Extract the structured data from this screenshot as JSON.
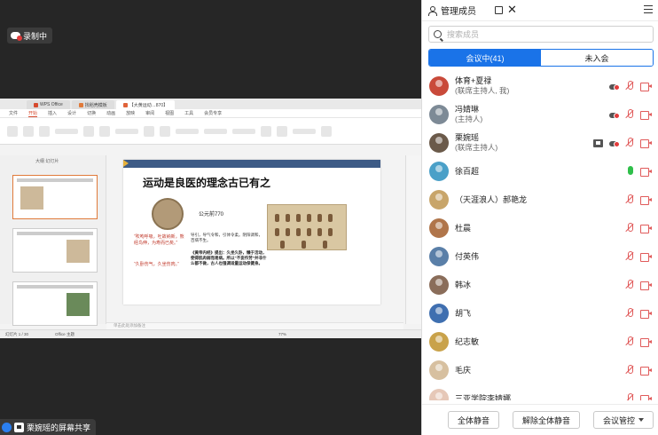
{
  "recording": {
    "label": "录制中"
  },
  "share": {
    "label": "栗婉瑶的屏幕共享"
  },
  "wps": {
    "tabs": [
      "WPS Office",
      "找稻壳模板",
      "【大黄运动…870】"
    ],
    "menu": [
      "文件",
      "开始",
      "插入",
      "设计",
      "切换",
      "动画",
      "放映",
      "审阅",
      "视图",
      "工具",
      "会员专享"
    ],
    "outline_tabs": "大纲 幻灯片",
    "notes_placeholder": "单击此处添加备注",
    "status_left": "幻灯片 1 / 30",
    "status_theme": "Office 主题",
    "status_zoom": "77%",
    "slide": {
      "title": "运动是良医的理念古已有之",
      "year": "公元前770",
      "red1": "“吹呴呼吸，吐故纳新，熊经鸟伸，为寿而已矣。”",
      "red2": "“久卧伤气，久坐伤肉。”",
      "text1": "导引，导气令和，引体令柔。阴阳调和，百病不生。",
      "text2": "《黄帝内经》提出：久坐久卧，懒于活动，使得肌肉弱而易病。所以“不妄作劳”并非什么都不做，古人也强调适量运动保健身。"
    }
  },
  "panel": {
    "title": "管理成员",
    "search_placeholder": "搜索成员",
    "tab_in": "会议中(41)",
    "tab_out": "未入会",
    "members": [
      {
        "name": "体育+夏禄",
        "role": "(联席主持人, 我)",
        "color": "#c94a3a",
        "icons": [
          "cloud",
          "mic-off",
          "cam-off"
        ]
      },
      {
        "name": "冯婧琳",
        "role": "(主持人)",
        "color": "#7d8a96",
        "icons": [
          "cloud",
          "mic-off",
          "cam-off"
        ]
      },
      {
        "name": "栗婉瑶",
        "role": "(联席主持人)",
        "color": "#6b5a4a",
        "icons": [
          "screen",
          "cloud",
          "mic-off",
          "cam-off"
        ]
      },
      {
        "name": "徐百超",
        "role": "",
        "color": "#4aa0c8",
        "icons": [
          "mic-on",
          "cam-off"
        ]
      },
      {
        "name": "（天涯浪人）郝艳龙",
        "role": "",
        "color": "#c8a56a",
        "icons": [
          "mic-off",
          "cam-off"
        ]
      },
      {
        "name": "杜晨",
        "role": "",
        "color": "#b0754a",
        "icons": [
          "mic-off",
          "cam-off"
        ]
      },
      {
        "name": "付英伟",
        "role": "",
        "color": "#5a7fa8",
        "icons": [
          "mic-off",
          "cam-off"
        ]
      },
      {
        "name": "韩冰",
        "role": "",
        "color": "#8a6d5a",
        "icons": [
          "mic-off",
          "cam-off"
        ]
      },
      {
        "name": "胡飞",
        "role": "",
        "color": "#3f6fb0",
        "icons": [
          "mic-off",
          "cam-off"
        ]
      },
      {
        "name": "纪志敏",
        "role": "",
        "color": "#c9a24a",
        "icons": [
          "mic-off",
          "cam-off"
        ]
      },
      {
        "name": "毛庆",
        "role": "",
        "color": "#d7c0a0",
        "icons": [
          "mic-off",
          "cam-off"
        ]
      },
      {
        "name": "三亚学院李婧娜",
        "role": "",
        "color": "#e6c8b8",
        "icons": [
          "mic-off",
          "cam-off"
        ]
      }
    ],
    "footer": {
      "mute_all": "全体静音",
      "unmute_all": "解除全体静音",
      "control": "会议管控"
    }
  }
}
